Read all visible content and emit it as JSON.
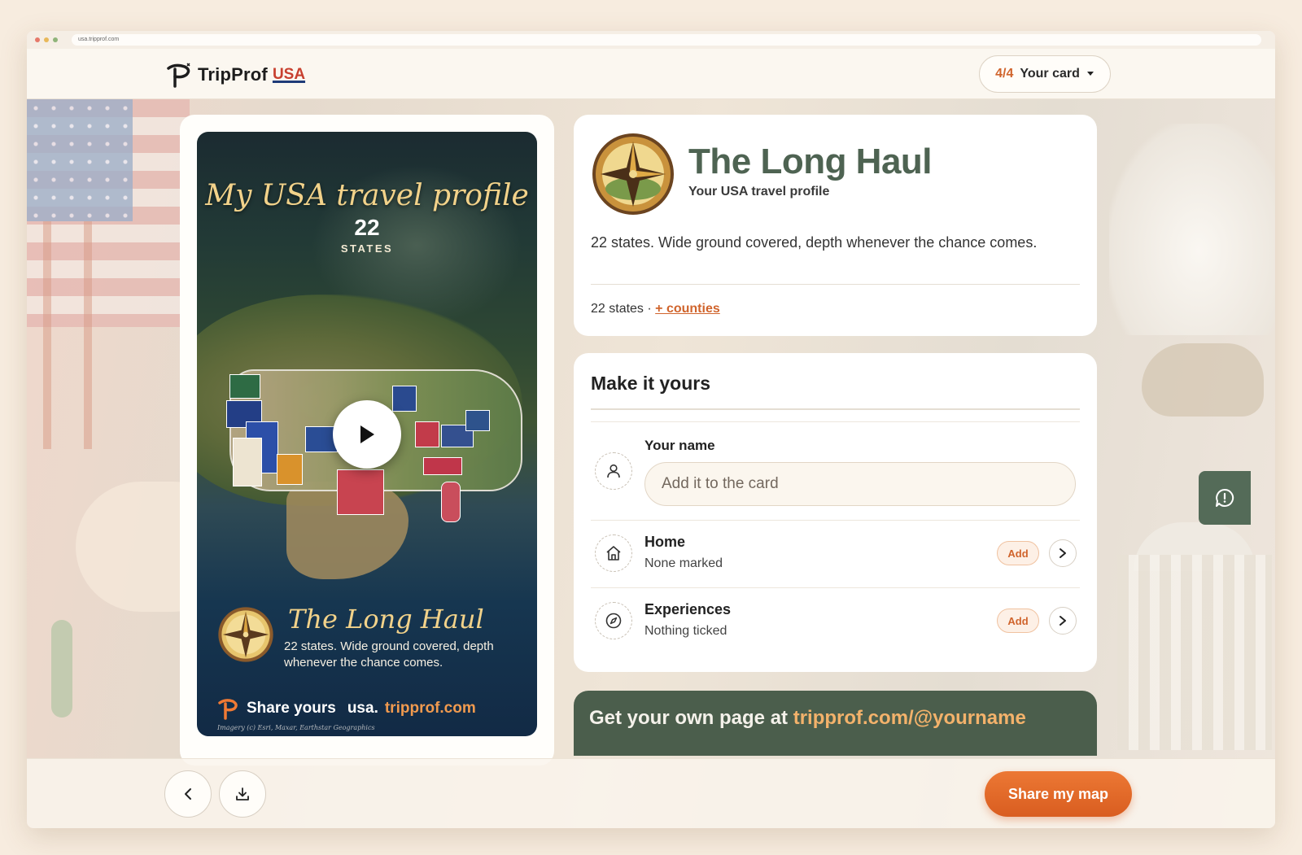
{
  "browser": {
    "url": "usa.tripprof.com",
    "dot_colors": [
      "#e6796a",
      "#e8b85a",
      "#8fb47a"
    ]
  },
  "header": {
    "logo_text": "TripProf",
    "logo_suffix": "USA",
    "card_progress": "4/4",
    "card_label": "Your card"
  },
  "story": {
    "title": "My USA travel profile",
    "states_count": "22",
    "states_label": "STATES",
    "profile_name": "The Long Haul",
    "description": "22 states. Wide ground covered, depth whenever the chance comes.",
    "share_label": "Share yours",
    "share_url_host": "usa.",
    "share_url_domain": "tripprof.com",
    "credit": "Imagery (c) Esri, Maxar, Earthstar Geographics"
  },
  "profile": {
    "title": "The Long Haul",
    "subtitle": "Your USA travel profile",
    "description": "22 states. Wide ground covered, depth whenever the chance comes.",
    "stats_prefix": "22 states · ",
    "counties_link": "+ counties"
  },
  "customize": {
    "heading": "Make it yours",
    "name_label": "Your name",
    "name_placeholder": "Add it to the card",
    "name_value": "",
    "rows": [
      {
        "title": "Home",
        "subtitle": "None marked",
        "add_label": "Add"
      },
      {
        "title": "Experiences",
        "subtitle": "Nothing ticked",
        "add_label": "Add"
      }
    ]
  },
  "promo": {
    "prefix": "Get your own page at ",
    "link": "tripprof.com/@yourname"
  },
  "footer": {
    "share_label": "Share my map"
  },
  "colors": {
    "accent_orange": "#d0642c",
    "primary_green": "#4e6352",
    "promo_green": "#4b5e4c",
    "promo_link": "#f3b26b"
  }
}
